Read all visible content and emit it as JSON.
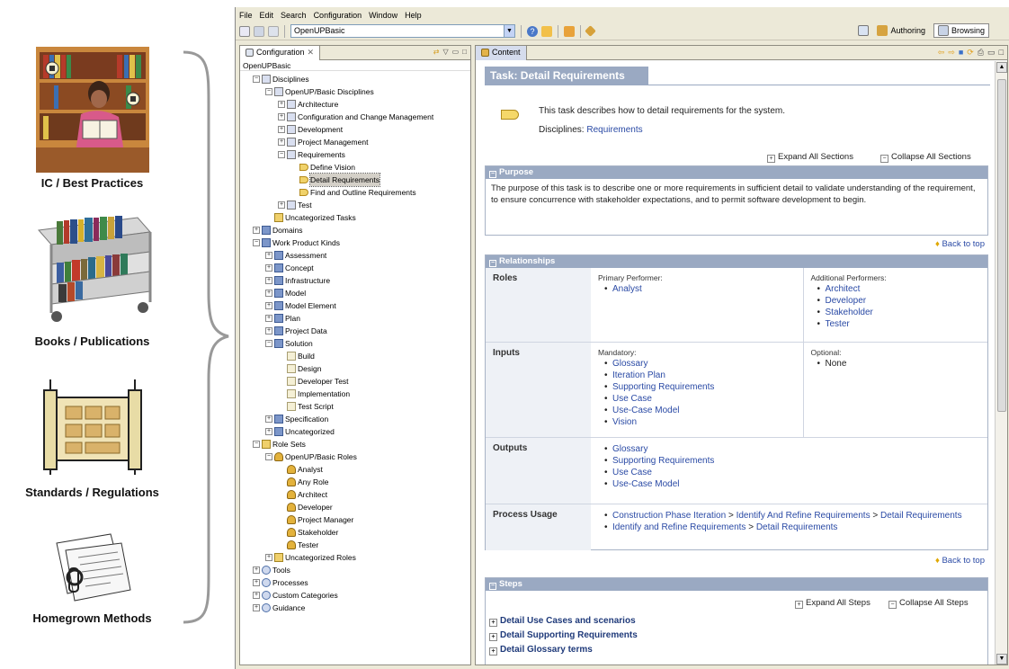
{
  "sources": [
    {
      "label": "IC / Best Practices"
    },
    {
      "label": "Books / Publications"
    },
    {
      "label": "Standards / Regulations"
    },
    {
      "label": "Homegrown Methods"
    }
  ],
  "menu": [
    "File",
    "Edit",
    "Search",
    "Configuration",
    "Window",
    "Help"
  ],
  "toolbar": {
    "config_combo": "OpenUPBasic",
    "authoring_label": "Authoring",
    "browsing_label": "Browsing"
  },
  "config_view": {
    "tab_label": "Configuration",
    "tab_close": "✕",
    "config_name": "OpenUPBasic"
  },
  "content_view": {
    "tab_label": "Content"
  },
  "tree": [
    {
      "label": "Disciplines",
      "depth": 0,
      "expander": "-",
      "icon": "disc"
    },
    {
      "label": "OpenUP/Basic Disciplines",
      "depth": 1,
      "expander": "-",
      "icon": "disc"
    },
    {
      "label": "Architecture",
      "depth": 2,
      "expander": "+",
      "icon": "disc"
    },
    {
      "label": "Configuration and Change Management",
      "depth": 2,
      "expander": "+",
      "icon": "disc"
    },
    {
      "label": "Development",
      "depth": 2,
      "expander": "+",
      "icon": "disc"
    },
    {
      "label": "Project Management",
      "depth": 2,
      "expander": "+",
      "icon": "disc"
    },
    {
      "label": "Requirements",
      "depth": 2,
      "expander": "-",
      "icon": "disc"
    },
    {
      "label": "Define Vision",
      "depth": 3,
      "expander": "",
      "icon": "task"
    },
    {
      "label": "Detail Requirements",
      "depth": 3,
      "expander": "",
      "icon": "task",
      "selected": true
    },
    {
      "label": "Find and Outline Requirements",
      "depth": 3,
      "expander": "",
      "icon": "task"
    },
    {
      "label": "Test",
      "depth": 2,
      "expander": "+",
      "icon": "disc"
    },
    {
      "label": "Uncategorized Tasks",
      "depth": 1,
      "expander": "",
      "icon": "fold"
    },
    {
      "label": "Domains",
      "depth": 0,
      "expander": "+",
      "icon": "wpk"
    },
    {
      "label": "Work Product Kinds",
      "depth": 0,
      "expander": "-",
      "icon": "wpk"
    },
    {
      "label": "Assessment",
      "depth": 1,
      "expander": "+",
      "icon": "wpk"
    },
    {
      "label": "Concept",
      "depth": 1,
      "expander": "+",
      "icon": "wpk"
    },
    {
      "label": "Infrastructure",
      "depth": 1,
      "expander": "+",
      "icon": "wpk"
    },
    {
      "label": "Model",
      "depth": 1,
      "expander": "+",
      "icon": "wpk"
    },
    {
      "label": "Model Element",
      "depth": 1,
      "expander": "+",
      "icon": "wpk"
    },
    {
      "label": "Plan",
      "depth": 1,
      "expander": "+",
      "icon": "wpk"
    },
    {
      "label": "Project Data",
      "depth": 1,
      "expander": "+",
      "icon": "wpk"
    },
    {
      "label": "Solution",
      "depth": 1,
      "expander": "-",
      "icon": "wpk"
    },
    {
      "label": "Build",
      "depth": 2,
      "expander": "",
      "icon": "doc"
    },
    {
      "label": "Design",
      "depth": 2,
      "expander": "",
      "icon": "doc"
    },
    {
      "label": "Developer Test",
      "depth": 2,
      "expander": "",
      "icon": "doc"
    },
    {
      "label": "Implementation",
      "depth": 2,
      "expander": "",
      "icon": "doc"
    },
    {
      "label": "Test Script",
      "depth": 2,
      "expander": "",
      "icon": "doc"
    },
    {
      "label": "Specification",
      "depth": 1,
      "expander": "+",
      "icon": "wpk"
    },
    {
      "label": "Uncategorized",
      "depth": 1,
      "expander": "+",
      "icon": "wpk"
    },
    {
      "label": "Role Sets",
      "depth": 0,
      "expander": "-",
      "icon": "fold"
    },
    {
      "label": "OpenUP/Basic Roles",
      "depth": 1,
      "expander": "-",
      "icon": "role"
    },
    {
      "label": "Analyst",
      "depth": 2,
      "expander": "",
      "icon": "role"
    },
    {
      "label": "Any Role",
      "depth": 2,
      "expander": "",
      "icon": "role"
    },
    {
      "label": "Architect",
      "depth": 2,
      "expander": "",
      "icon": "role"
    },
    {
      "label": "Developer",
      "depth": 2,
      "expander": "",
      "icon": "role"
    },
    {
      "label": "Project Manager",
      "depth": 2,
      "expander": "",
      "icon": "role"
    },
    {
      "label": "Stakeholder",
      "depth": 2,
      "expander": "",
      "icon": "role"
    },
    {
      "label": "Tester",
      "depth": 2,
      "expander": "",
      "icon": "role"
    },
    {
      "label": "Uncategorized Roles",
      "depth": 1,
      "expander": "+",
      "icon": "fold"
    },
    {
      "label": "Tools",
      "depth": 0,
      "expander": "+",
      "icon": "misc"
    },
    {
      "label": "Processes",
      "depth": 0,
      "expander": "+",
      "icon": "misc"
    },
    {
      "label": "Custom Categories",
      "depth": 0,
      "expander": "+",
      "icon": "misc"
    },
    {
      "label": "Guidance",
      "depth": 0,
      "expander": "+",
      "icon": "misc"
    }
  ],
  "task": {
    "title": "Task: Detail Requirements",
    "description": "This task describes how to detail requirements for the system.",
    "disciplines_label": "Disciplines:",
    "disciplines_value": "Requirements",
    "expand_all": "Expand All Sections",
    "collapse_all": "Collapse All Sections",
    "back_to_top": "Back to top",
    "purpose_heading": "Purpose",
    "purpose_text": "The purpose of this task is to describe one or more requirements in sufficient detail to validate understanding of the requirement, to ensure concurrence with stakeholder expectations, and to permit software development to begin.",
    "relationships_heading": "Relationships",
    "roles": {
      "label": "Roles",
      "primary_label": "Primary Performer:",
      "primary": [
        "Analyst"
      ],
      "additional_label": "Additional Performers:",
      "additional": [
        "Architect",
        "Developer",
        "Stakeholder",
        "Tester"
      ]
    },
    "inputs": {
      "label": "Inputs",
      "mandatory_label": "Mandatory:",
      "mandatory": [
        "Glossary",
        "Iteration Plan",
        "Supporting Requirements",
        "Use Case",
        "Use-Case Model",
        "Vision"
      ],
      "optional_label": "Optional:",
      "optional": [
        "None"
      ]
    },
    "outputs": {
      "label": "Outputs",
      "items": [
        "Glossary",
        "Supporting Requirements",
        "Use Case",
        "Use-Case Model"
      ]
    },
    "process_usage": {
      "label": "Process Usage",
      "line1_a": "Construction Phase Iteration",
      "line1_b": "Identify And Refine Requirements",
      "line1_c": "Detail Requirements",
      "line2_a": "Identify and Refine Requirements",
      "line2_b": "Detail Requirements",
      "sep": ">"
    },
    "steps_heading": "Steps",
    "expand_steps": "Expand All Steps",
    "collapse_steps": "Collapse All Steps",
    "steps": [
      "Detail Use Cases and scenarios",
      "Detail Supporting Requirements",
      "Detail Glossary terms"
    ]
  }
}
